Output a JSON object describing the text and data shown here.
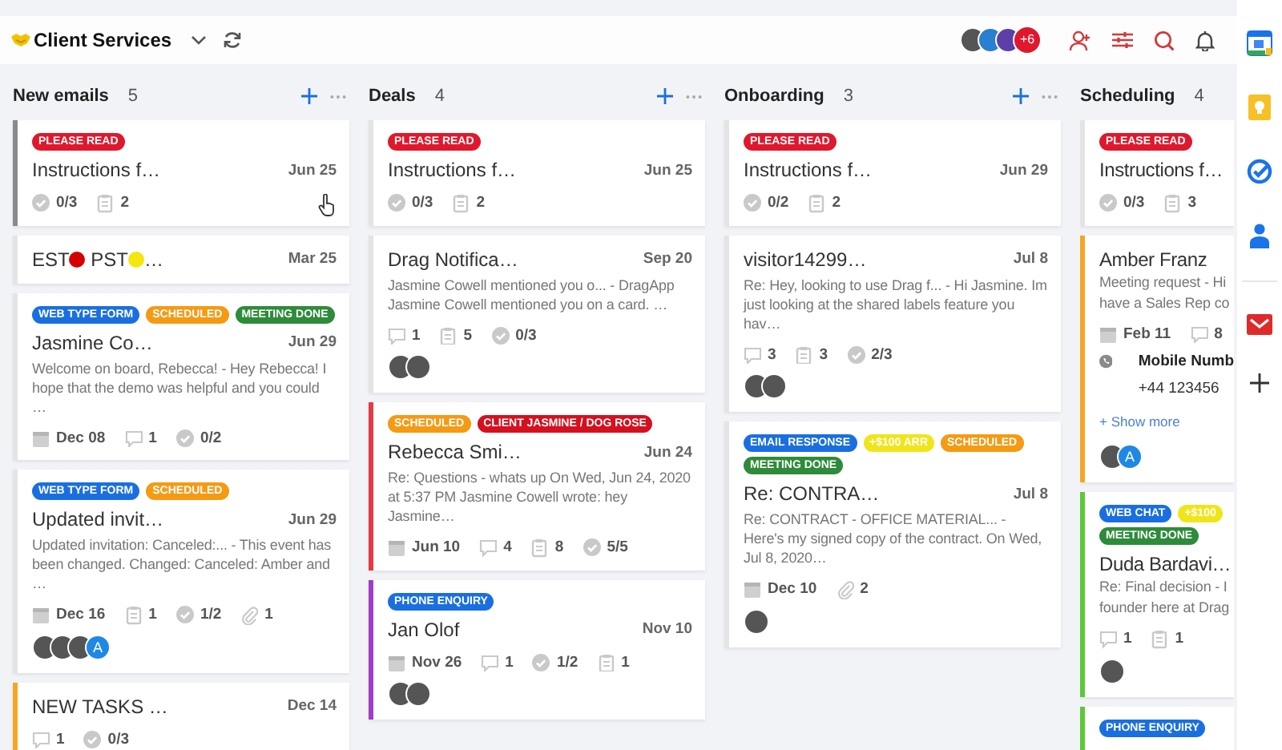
{
  "board": {
    "title": "Client Services"
  },
  "members": [
    {
      "kind": "photo"
    },
    {
      "kind": "photo"
    },
    {
      "kind": "photo"
    }
  ],
  "extra_members": "+6",
  "columns": [
    {
      "name": "New emails",
      "count": "5",
      "cards": [
        {
          "color": "#8a8a8a",
          "pointer": true,
          "tags": [
            {
              "label": "PLEASE READ",
              "color": "#e0182d"
            }
          ],
          "title_parts": [
            {
              "kind": "text",
              "text": "Instructions f…"
            }
          ],
          "date": "Jun 25",
          "meta": [
            {
              "kind": "checklist",
              "value": "0/3"
            },
            {
              "kind": "subtasks",
              "value": "2"
            }
          ]
        },
        {
          "color": "#e4e4e4",
          "title_parts": [
            {
              "kind": "text",
              "text": "EST"
            },
            {
              "kind": "dot",
              "color": "#d50000"
            },
            {
              "kind": "text",
              "text": " PST"
            },
            {
              "kind": "dot",
              "color": "#f5e60c"
            },
            {
              "kind": "text",
              "text": "…"
            }
          ],
          "date": "Mar 25"
        },
        {
          "color": "#e4e4e4",
          "tags": [
            {
              "label": "WEB TYPE FORM",
              "color": "#1a6fe0"
            },
            {
              "label": "SCHEDULED",
              "color": "#f59a13"
            },
            {
              "label": "MEETING DONE",
              "color": "#2e8b3a"
            }
          ],
          "title_parts": [
            {
              "kind": "text",
              "text": "Jasmine Co…"
            }
          ],
          "date": "Jun 29",
          "snippet": "Welcome on board, Rebecca! - Hey Rebecca! I hope that the demo was helpful and you could …",
          "meta": [
            {
              "kind": "due",
              "value": "Dec 08"
            },
            {
              "kind": "comments",
              "value": "1"
            },
            {
              "kind": "checklist",
              "value": "0/2"
            }
          ]
        },
        {
          "color": "#e4e4e4",
          "tags": [
            {
              "label": "WEB TYPE FORM",
              "color": "#1a6fe0"
            },
            {
              "label": "SCHEDULED",
              "color": "#f59a13"
            }
          ],
          "title_parts": [
            {
              "kind": "text",
              "text": "Updated invit…"
            }
          ],
          "date": "Jun 29",
          "snippet": "Updated invitation: Canceled:... - This event has been changed. Changed: Canceled: Amber and …",
          "meta": [
            {
              "kind": "due",
              "value": "Dec 16"
            },
            {
              "kind": "subtasks",
              "value": "1"
            },
            {
              "kind": "checklist",
              "value": "1/2"
            },
            {
              "kind": "attachments",
              "value": "1"
            }
          ],
          "avatars": [
            {
              "kind": "photo"
            },
            {
              "kind": "photo"
            },
            {
              "kind": "photo"
            },
            {
              "kind": "letter",
              "letter": "A"
            }
          ]
        },
        {
          "color": "#f5a623",
          "title_parts": [
            {
              "kind": "text",
              "text": "NEW TASKS …"
            }
          ],
          "date": "Dec 14",
          "meta": [
            {
              "kind": "comments",
              "value": "1"
            },
            {
              "kind": "checklist",
              "value": "0/3"
            }
          ]
        }
      ]
    },
    {
      "name": "Deals",
      "count": "4",
      "cards": [
        {
          "color": "#e4e4e4",
          "tags": [
            {
              "label": "PLEASE READ",
              "color": "#e0182d"
            }
          ],
          "title_parts": [
            {
              "kind": "text",
              "text": "Instructions f…"
            }
          ],
          "date": "Jun 25",
          "meta": [
            {
              "kind": "checklist",
              "value": "0/3"
            },
            {
              "kind": "subtasks",
              "value": "2"
            }
          ]
        },
        {
          "color": "#e4e4e4",
          "title_parts": [
            {
              "kind": "text",
              "text": "Drag Notifica…"
            }
          ],
          "date": "Sep 20",
          "snippet": "Jasmine Cowell mentioned you o... - DragApp Jasmine Cowell mentioned you on a card. …",
          "meta": [
            {
              "kind": "comments",
              "value": "1"
            },
            {
              "kind": "subtasks",
              "value": "5"
            },
            {
              "kind": "checklist",
              "value": "0/3"
            }
          ],
          "avatars": [
            {
              "kind": "photo"
            },
            {
              "kind": "photo"
            }
          ]
        },
        {
          "color": "#e53945",
          "tags": [
            {
              "label": "SCHEDULED",
              "color": "#f59a13"
            },
            {
              "label": "CLIENT JASMINE / DOG ROSE",
              "color": "#d5101f"
            }
          ],
          "title_parts": [
            {
              "kind": "text",
              "text": "Rebecca Smi…"
            }
          ],
          "date": "Jun 24",
          "snippet": "Re: Questions - whats up On Wed, Jun 24, 2020 at 5:37 PM Jasmine Cowell  wrote: hey Jasmine…",
          "meta": [
            {
              "kind": "due",
              "value": "Jun 10"
            },
            {
              "kind": "comments",
              "value": "4"
            },
            {
              "kind": "subtasks",
              "value": "8"
            },
            {
              "kind": "checklist",
              "value": "5/5"
            }
          ]
        },
        {
          "color": "#a03cc8",
          "tags": [
            {
              "label": "PHONE ENQUIRY",
              "color": "#1a6fe0"
            }
          ],
          "title_parts": [
            {
              "kind": "text",
              "text": "Jan Olof"
            }
          ],
          "date": "Nov 10",
          "meta": [
            {
              "kind": "due",
              "value": "Nov 26"
            },
            {
              "kind": "comments",
              "value": "1"
            },
            {
              "kind": "checklist",
              "value": "1/2"
            },
            {
              "kind": "subtasks",
              "value": "1"
            }
          ],
          "avatars": [
            {
              "kind": "photo"
            },
            {
              "kind": "photo"
            }
          ]
        }
      ]
    },
    {
      "name": "Onboarding",
      "count": "3",
      "cards": [
        {
          "color": "#e4e4e4",
          "tags": [
            {
              "label": "PLEASE READ",
              "color": "#e0182d"
            }
          ],
          "title_parts": [
            {
              "kind": "text",
              "text": "Instructions f…"
            }
          ],
          "date": "Jun 29",
          "meta": [
            {
              "kind": "checklist",
              "value": "0/2"
            },
            {
              "kind": "subtasks",
              "value": "2"
            }
          ]
        },
        {
          "color": "#e4e4e4",
          "title_parts": [
            {
              "kind": "text",
              "text": "visitor14299…"
            }
          ],
          "date": "Jul 8",
          "snippet": "Re: Hey, looking to use Drag f... - Hi Jasmine. Im just looking at the shared labels feature you hav…",
          "meta": [
            {
              "kind": "comments",
              "value": "3"
            },
            {
              "kind": "subtasks",
              "value": "3"
            },
            {
              "kind": "checklist",
              "value": "2/3"
            }
          ],
          "avatars": [
            {
              "kind": "photo"
            },
            {
              "kind": "photo"
            }
          ]
        },
        {
          "color": "#e4e4e4",
          "tags": [
            {
              "label": "EMAIL RESPONSE",
              "color": "#1a6fe0"
            },
            {
              "label": "+$100 ARR",
              "color": "#f0e51a"
            },
            {
              "label": "SCHEDULED",
              "color": "#f59a13"
            },
            {
              "label": "MEETING DONE",
              "color": "#2e8b3a"
            }
          ],
          "title_parts": [
            {
              "kind": "text",
              "text": "Re: CONTRA…"
            }
          ],
          "date": "Jul 8",
          "snippet": "Re: CONTRACT - OFFICE MATERIAL... - Here's my signed copy of the contract. On Wed, Jul 8, 2020…",
          "meta": [
            {
              "kind": "due",
              "value": "Dec 10"
            },
            {
              "kind": "attachments",
              "value": "2"
            }
          ],
          "avatars": [
            {
              "kind": "photo"
            }
          ]
        }
      ]
    },
    {
      "name": "Scheduling",
      "count": "4",
      "cards": [
        {
          "color": "#e4e4e4",
          "tags": [
            {
              "label": "PLEASE READ",
              "color": "#e0182d"
            }
          ],
          "title_parts": [
            {
              "kind": "text",
              "text": "Instructions f…"
            }
          ],
          "meta": [
            {
              "kind": "checklist",
              "value": "0/3"
            },
            {
              "kind": "subtasks",
              "value": "3"
            }
          ]
        },
        {
          "color": "#f5a623",
          "title_parts": [
            {
              "kind": "text",
              "text": "Amber Franz"
            }
          ],
          "snippet_lines": [
            "Meeting request - Hi",
            "have a Sales Rep co"
          ],
          "meta": [
            {
              "kind": "due",
              "value": "Feb 11"
            },
            {
              "kind": "comments",
              "value": "8"
            }
          ],
          "contact": {
            "label": "Mobile Numb",
            "value": "+44 123456"
          },
          "show_more": "+ Show more",
          "avatars": [
            {
              "kind": "photo"
            },
            {
              "kind": "letter",
              "letter": "A"
            }
          ]
        },
        {
          "color": "#5cc93a",
          "tags": [
            {
              "label": "WEB CHAT",
              "color": "#1a6fe0"
            },
            {
              "label": "+$100",
              "color": "#f0e51a"
            },
            {
              "label": "MEETING DONE",
              "color": "#2e8b3a"
            }
          ],
          "title_parts": [
            {
              "kind": "text",
              "text": "Duda Bardavi…"
            }
          ],
          "snippet_lines": [
            "Re: Final decision - I",
            "founder here at Drag"
          ],
          "meta": [
            {
              "kind": "comments",
              "value": "1"
            },
            {
              "kind": "subtasks",
              "value": "1"
            }
          ],
          "avatars": [
            {
              "kind": "photo"
            }
          ]
        },
        {
          "color": "#5cc93a",
          "tags": [
            {
              "label": "PHONE ENQUIRY",
              "color": "#1a6fe0"
            }
          ]
        }
      ]
    }
  ]
}
